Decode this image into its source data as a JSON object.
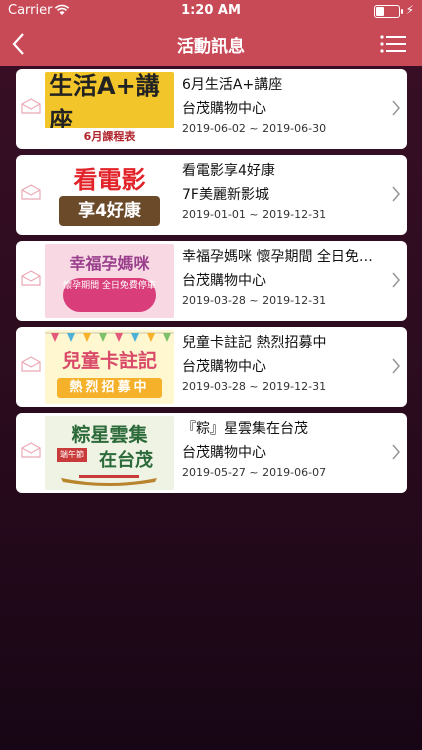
{
  "status_bar": {
    "carrier": "Carrier",
    "time": "1:20 AM"
  },
  "nav": {
    "title": "活動訊息",
    "back_icon": "chevron-left-icon",
    "menu_icon": "list-menu-icon"
  },
  "colors": {
    "header": "#c84a57",
    "background": "#2a0b1e",
    "card": "#ffffff"
  },
  "events": [
    {
      "title": "6月生活A+講座",
      "place": "台茂購物中心",
      "date": "2019-06-02 ~ 2019-06-30",
      "thumb": {
        "main": "生活A+講座",
        "sub": "6月課程表"
      }
    },
    {
      "title": "看電影享4好康",
      "place": "7F美麗新影城",
      "date": "2019-01-01 ~ 2019-12-31",
      "thumb": {
        "main": "看電影",
        "sub": "享4好康"
      }
    },
    {
      "title": "幸福孕媽咪 懷孕期間 全日免…",
      "place": "台茂購物中心",
      "date": "2019-03-28 ~ 2019-12-31",
      "thumb": {
        "main": "幸福孕媽咪",
        "sub": "懷孕期間 全日免費停車"
      }
    },
    {
      "title": "兒童卡註記 熱烈招募中",
      "place": "台茂購物中心",
      "date": "2019-03-28 ~ 2019-12-31",
      "thumb": {
        "main": "兒童卡註記",
        "sub": "熱烈招募中"
      }
    },
    {
      "title": "『粽』星雲集在台茂",
      "place": "台茂購物中心",
      "date": "2019-05-27 ~ 2019-06-07",
      "thumb": {
        "main": "粽星雲集",
        "tag": "端午節",
        "sub": "在台茂"
      }
    }
  ]
}
